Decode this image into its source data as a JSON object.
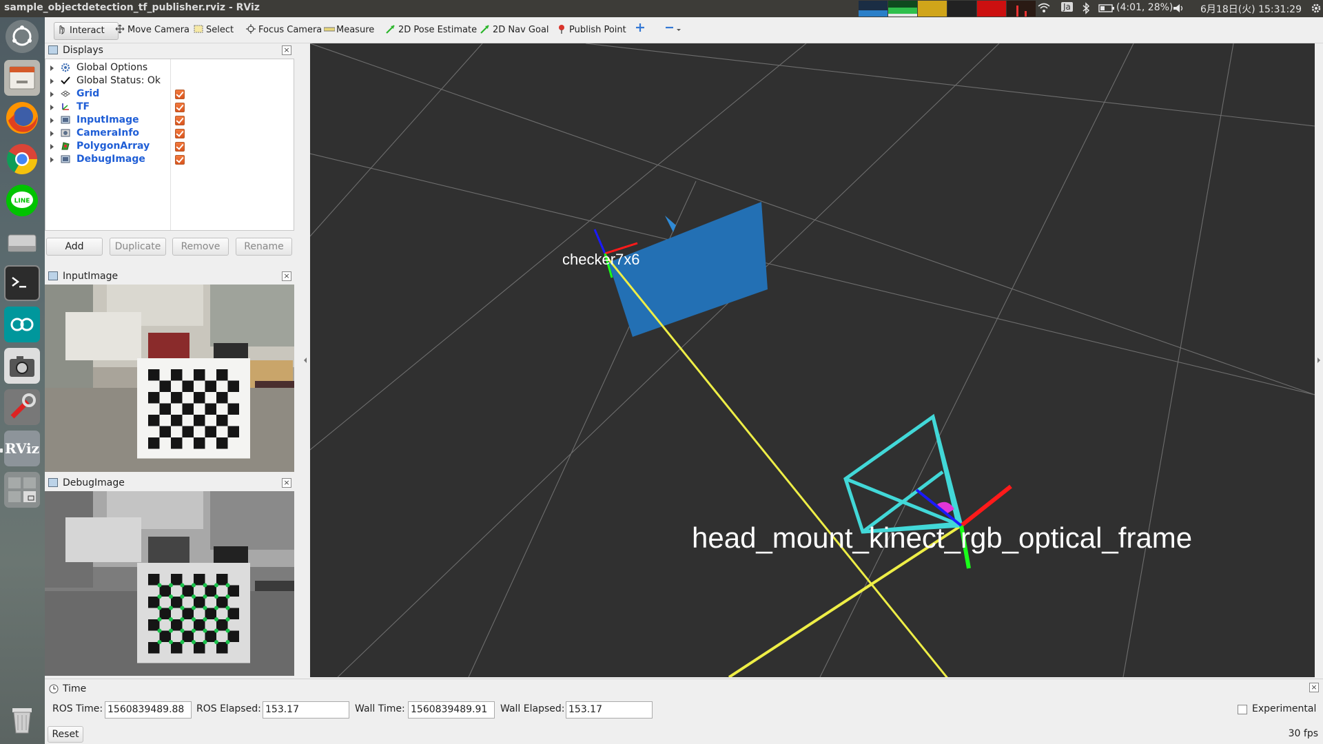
{
  "window": {
    "title": "sample_objectdetection_tf_publisher.rviz - RViz"
  },
  "tray": {
    "ime": "Ja",
    "battery": "(4:01, 28%)",
    "datetime": "6月18日(火) 15:31:29"
  },
  "launcher": {
    "items": [
      "Search your computer",
      "Files",
      "Firefox Web Browser",
      "Google Chrome",
      "LINE",
      "Disks",
      "Terminal",
      "Arduino IDE",
      "Screenshot",
      "System Settings",
      "RViz",
      "Workspace Switcher",
      "Trash"
    ]
  },
  "toolbar": {
    "tools": [
      {
        "label": "Interact",
        "icon": "hand-icon"
      },
      {
        "label": "Move Camera",
        "icon": "move-camera-icon"
      },
      {
        "label": "Select",
        "icon": "select-icon"
      },
      {
        "label": "Focus Camera",
        "icon": "focus-camera-icon"
      },
      {
        "label": "Measure",
        "icon": "ruler-icon"
      },
      {
        "label": "2D Pose Estimate",
        "icon": "green-arrow-icon"
      },
      {
        "label": "2D Nav Goal",
        "icon": "green-arrow-icon"
      },
      {
        "label": "Publish Point",
        "icon": "pin-icon"
      }
    ]
  },
  "displays": {
    "title": "Displays",
    "items": [
      {
        "label": "Global Options",
        "checked": null
      },
      {
        "label": "Global Status: Ok",
        "checked": null
      },
      {
        "label": "Grid",
        "checked": true
      },
      {
        "label": "TF",
        "checked": true
      },
      {
        "label": "InputImage",
        "checked": true
      },
      {
        "label": "CameraInfo",
        "checked": true
      },
      {
        "label": "PolygonArray",
        "checked": true
      },
      {
        "label": "DebugImage",
        "checked": true
      }
    ],
    "buttons": {
      "add": "Add",
      "duplicate": "Duplicate",
      "remove": "Remove",
      "rename": "Rename"
    }
  },
  "input_image": {
    "title": "InputImage"
  },
  "debug_image": {
    "title": "DebugImage"
  },
  "viewport": {
    "labels": {
      "checker": "checker7x6",
      "camera_frame": "head_mount_kinect_rgb_optical_frame"
    }
  },
  "time": {
    "title": "Time",
    "ros_time_label": "ROS Time:",
    "ros_time": "1560839489.88",
    "ros_elapsed_label": "ROS Elapsed:",
    "ros_elapsed": "153.17",
    "wall_time_label": "Wall Time:",
    "wall_time": "1560839489.91",
    "wall_elapsed_label": "Wall Elapsed:",
    "wall_elapsed": "153.17",
    "experimental": "Experimental",
    "reset": "Reset",
    "fps": "30 fps"
  }
}
